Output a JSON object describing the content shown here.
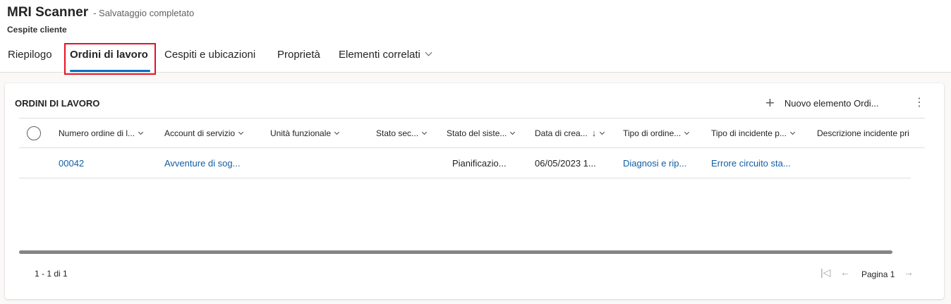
{
  "header": {
    "record_title": "MRI Scanner",
    "save_status": "- Salvataggio completato",
    "entity_name": "Cespite cliente"
  },
  "tabs": [
    {
      "label": "Riepilogo"
    },
    {
      "label": "Ordini di lavoro"
    },
    {
      "label": "Cespiti e ubicazioni"
    },
    {
      "label": "Proprietà"
    },
    {
      "label": "Elementi correlati"
    }
  ],
  "subgrid": {
    "title": "ORDINI DI LAVORO",
    "new_button_label": "Nuovo elemento Ordi...",
    "more_icon": "more-vertical-icon",
    "columns": [
      "Numero ordine di l...",
      "Account di servizio",
      "Unità funzionale",
      "Stato sec...",
      "Stato del siste...",
      "Data di crea...",
      "Tipo di ordine...",
      "Tipo di incidente p...",
      "Descrizione incidente pri"
    ],
    "rows": [
      {
        "numero": "00042",
        "account": "Avventure di sog...",
        "unita": "",
        "stato_sec": "",
        "stato_sistema": "Pianificazio...",
        "data": "06/05/2023 1...",
        "tipo_ordine": "Diagnosi e rip...",
        "tipo_incidente": "Errore circuito sta...",
        "descrizione": ""
      }
    ],
    "footer_count": "1 - 1 di 1",
    "page_label": "Pagina 1"
  },
  "colors": {
    "accent": "#0f6cbd",
    "link": "#115ea3",
    "highlight_border": "#e81123"
  }
}
